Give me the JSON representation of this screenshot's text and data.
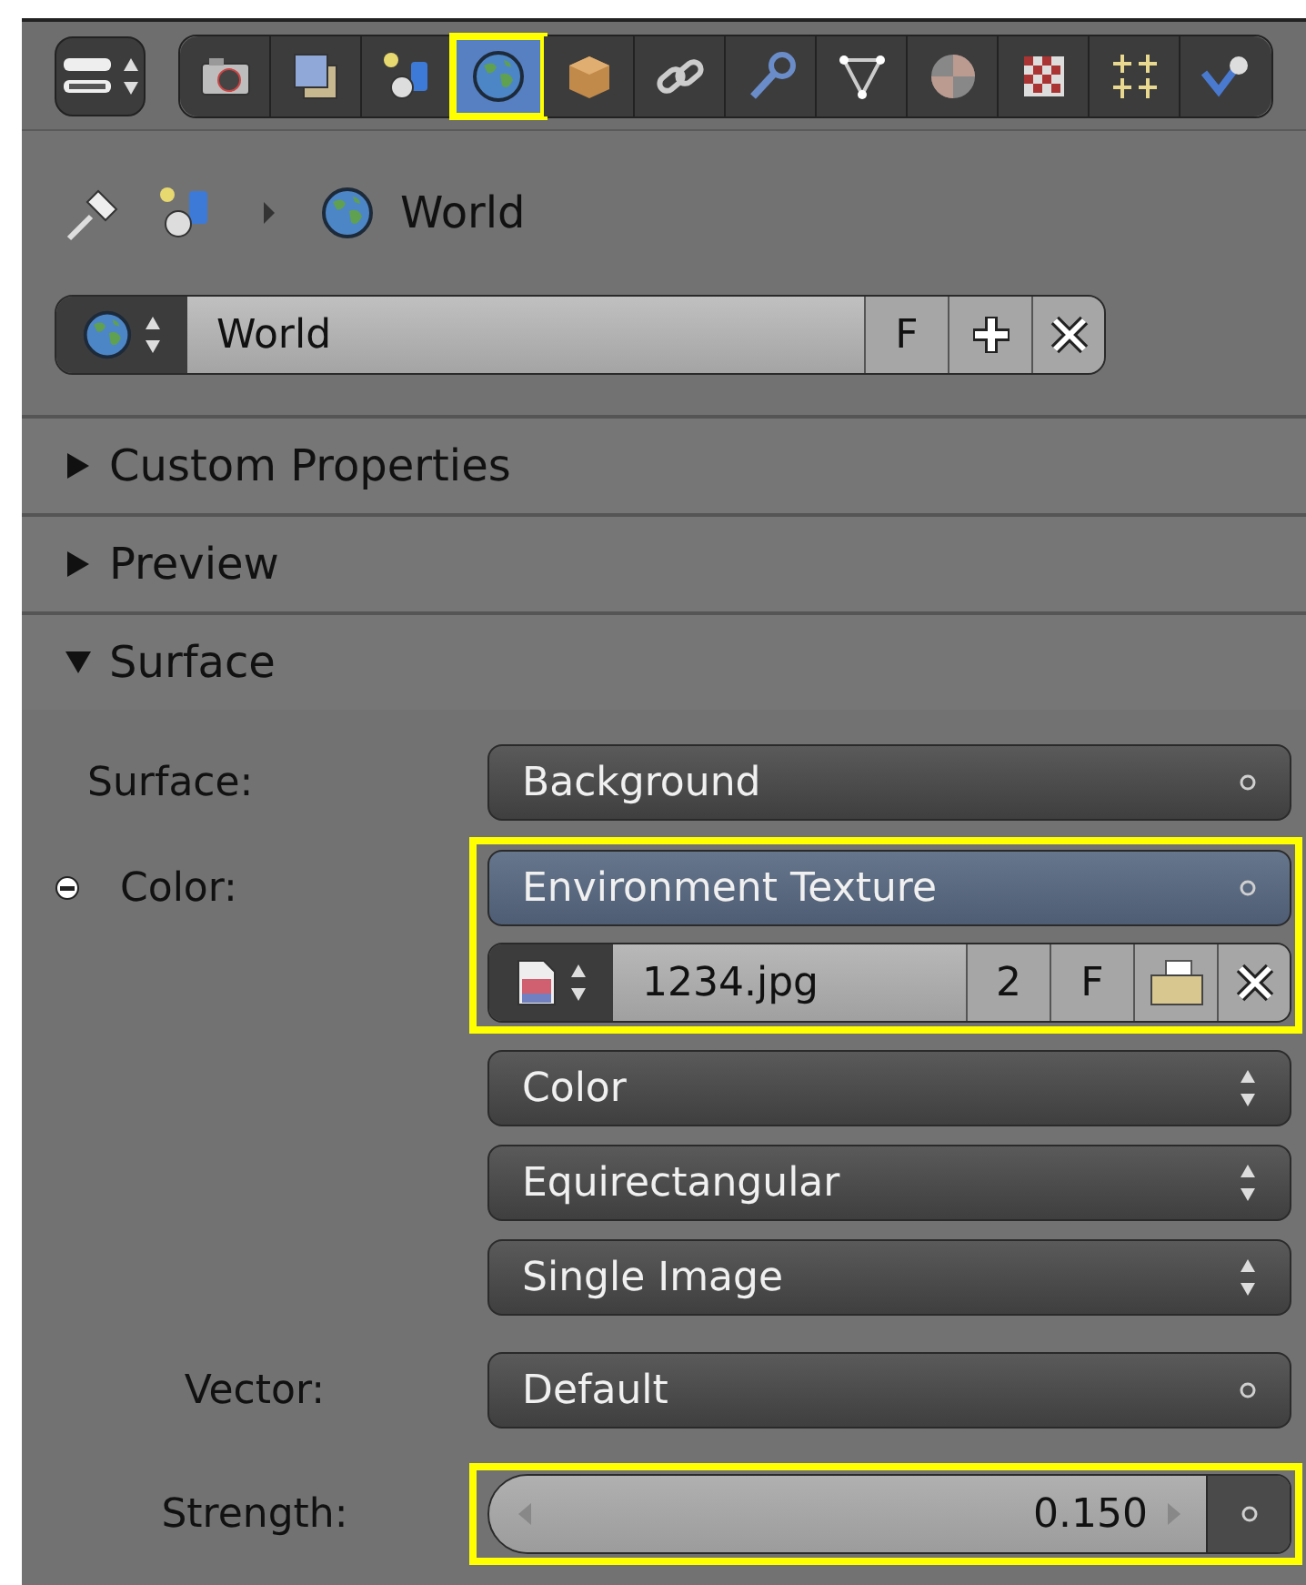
{
  "tabs": [
    {
      "selected": false,
      "highlighted": false
    },
    {
      "selected": false,
      "highlighted": false
    },
    {
      "selected": false,
      "highlighted": false
    },
    {
      "selected": true,
      "highlighted": true
    },
    {
      "selected": false,
      "highlighted": false
    },
    {
      "selected": false,
      "highlighted": false
    },
    {
      "selected": false,
      "highlighted": false
    },
    {
      "selected": false,
      "highlighted": false
    },
    {
      "selected": false,
      "highlighted": false
    },
    {
      "selected": false,
      "highlighted": false
    },
    {
      "selected": false,
      "highlighted": false
    },
    {
      "selected": false,
      "highlighted": false
    }
  ],
  "breadcrumb": {
    "label": "World"
  },
  "datablock": {
    "name": "World",
    "fake_user": "F"
  },
  "panels": [
    {
      "title": "Custom Properties",
      "expanded": false
    },
    {
      "title": "Preview",
      "expanded": false
    },
    {
      "title": "Surface",
      "expanded": true
    }
  ],
  "surface_rows": [
    {
      "kind": "shader",
      "label": "Surface:",
      "value": "Background",
      "highlighted": false
    },
    {
      "kind": "linked",
      "label": "Color:",
      "value": "Environment Texture",
      "highlighted": true
    },
    {
      "kind": "image",
      "name": "1234.jpg",
      "users": "2",
      "fake_user": "F",
      "highlighted": true
    },
    {
      "kind": "enum",
      "value": "Color",
      "highlighted": false
    },
    {
      "kind": "enum",
      "value": "Equirectangular",
      "highlighted": false
    },
    {
      "kind": "enum",
      "value": "Single Image",
      "highlighted": false
    },
    {
      "kind": "input",
      "label": "Vector:",
      "value": "Default",
      "highlighted": false
    },
    {
      "kind": "number",
      "label": "Strength:",
      "value": "0.150",
      "highlighted": true
    }
  ]
}
